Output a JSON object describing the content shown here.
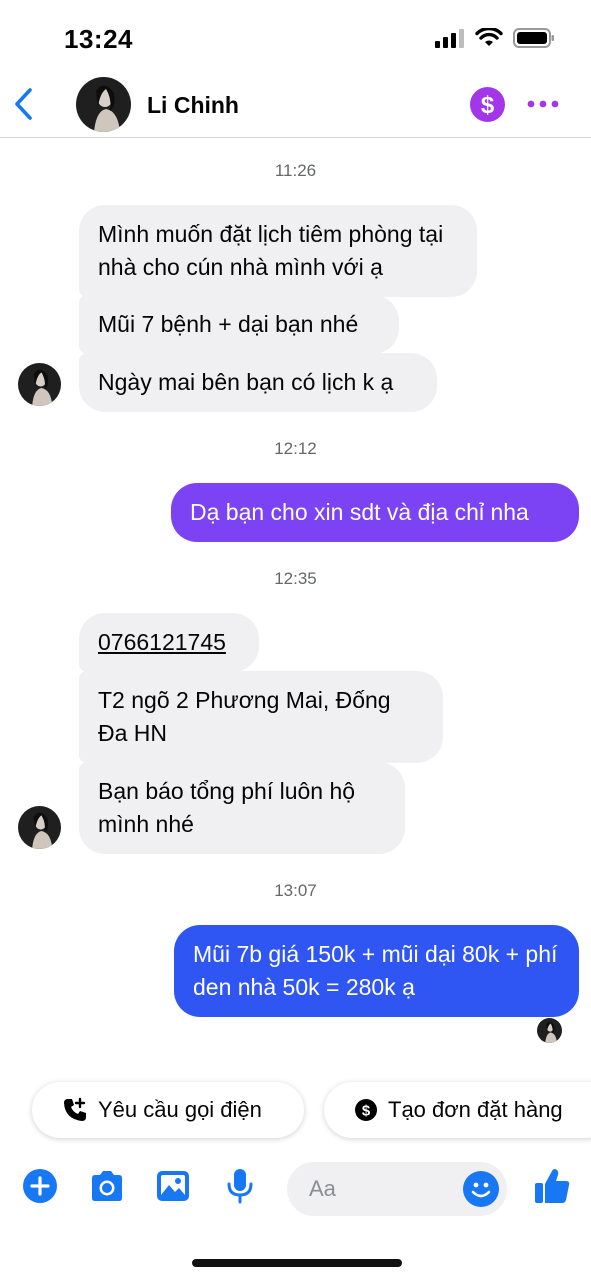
{
  "status_bar": {
    "time": "13:24"
  },
  "header": {
    "contact_name": "Li Chinh",
    "pay_symbol": "$"
  },
  "chat": {
    "timestamps": [
      "11:26",
      "12:12",
      "12:35",
      "13:07"
    ],
    "messages": [
      {
        "id": "m1",
        "sender": "contact",
        "text": "Mình muốn đặt lịch tiêm phòng tại nhà cho cún nhà mình với ạ"
      },
      {
        "id": "m2",
        "sender": "contact",
        "text": "Mũi 7 bệnh + dại bạn nhé"
      },
      {
        "id": "m3",
        "sender": "contact",
        "text": "Ngày mai bên bạn có lịch k ạ"
      },
      {
        "id": "m4",
        "sender": "me",
        "text": "Dạ bạn cho xin sdt và địa chỉ nha"
      },
      {
        "id": "m5",
        "sender": "contact",
        "text": "0766121745"
      },
      {
        "id": "m6",
        "sender": "contact",
        "text": "T2 ngõ 2 Phương Mai, Đống Đa HN"
      },
      {
        "id": "m7",
        "sender": "contact",
        "text": "Bạn báo tổng phí luôn hộ mình nhé"
      },
      {
        "id": "m8",
        "sender": "me",
        "text": "Mũi 7b giá 150k + mũi dại 80k + phí den nhà 50k = 280k ạ"
      }
    ]
  },
  "quick_replies": [
    {
      "label": "Yêu cầu gọi điện",
      "icon": "phone-plus-icon"
    },
    {
      "label": "Tạo đơn đặt hàng",
      "icon": "dollar-circle-icon"
    }
  ],
  "composer": {
    "placeholder": "Aa"
  },
  "colors": {
    "accent": "#1877f2",
    "purple_bubble": "#7b43f3",
    "blue_bubble": "#2f56f2",
    "incoming_bubble": "#f0f0f3",
    "pay_button": "#a336e8"
  }
}
